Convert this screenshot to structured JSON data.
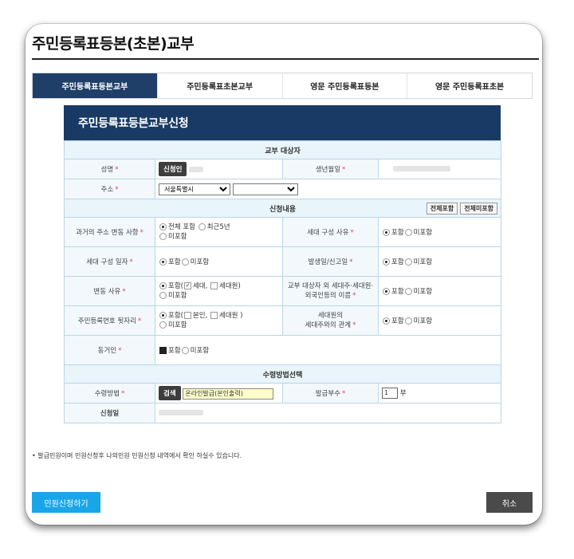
{
  "page_title": "주민등록표등본(초본)교부",
  "tabs": [
    {
      "label": "주민등록표등본교부",
      "active": true
    },
    {
      "label": "주민등록표초본교부",
      "active": false
    },
    {
      "label": "영문 주민등록표등본",
      "active": false
    },
    {
      "label": "영문 주민등록표초본",
      "active": false
    }
  ],
  "form": {
    "header": "주민등록표등본교부신청",
    "section_target": "교부 대상자",
    "name_label": "성명",
    "applicant_button": "신청인",
    "birth_label": "생년월일",
    "address_label": "주소",
    "address_city": "서울특별시",
    "address_district": "",
    "section_content": "신청내용",
    "include_all": "전체포함",
    "exclude_all": "전체미포함",
    "past_address_label": "과거의 주소 변동 사항",
    "past_opt_all": "전체 포함",
    "past_opt_recent": "최근5년",
    "past_opt_none": "미포함",
    "household_reason_label": "세대 구성 사유",
    "household_date_label": "세대 구성 일자",
    "occur_date_label": "발생일/신고일",
    "change_reason_label": "변동 사유",
    "change_sub_household": "세대,",
    "change_sub_member": "세대원)",
    "foreigner_label_1": "교부 대상자 외 세대주·세대원·",
    "foreigner_label_2": "외국인등의 이름",
    "rrn_label": "주민등록번호 뒷자리",
    "rrn_sub_self": "본인,",
    "rrn_sub_member": "세대원 )",
    "relation_label_1": "세대원의",
    "relation_label_2": "세대주와의 관계",
    "cohabitant_label": "동거인",
    "include": "포함",
    "include_paren": "포함(",
    "exclude": "미포함",
    "section_receive": "수령방법선택",
    "receive_label": "수령방법",
    "search_button": "검색",
    "receive_value": "온라인발급(본인출력)",
    "copies_label": "발급부수",
    "copies_value": "1",
    "copies_unit": "부",
    "apply_date_label": "신청일",
    "required_mark": "*"
  },
  "notice": "• 발급민원이며 민원신청후 나의민원 민원신청 내역에서 확인 하실수 있습니다.",
  "buttons": {
    "submit": "민원신청하기",
    "cancel": "취소"
  },
  "colors": {
    "tab_active": "#1f3f68",
    "form_header": "#183a64",
    "submit": "#19a6e8",
    "cancel": "#4a4a4a",
    "required": "#e0454f"
  }
}
